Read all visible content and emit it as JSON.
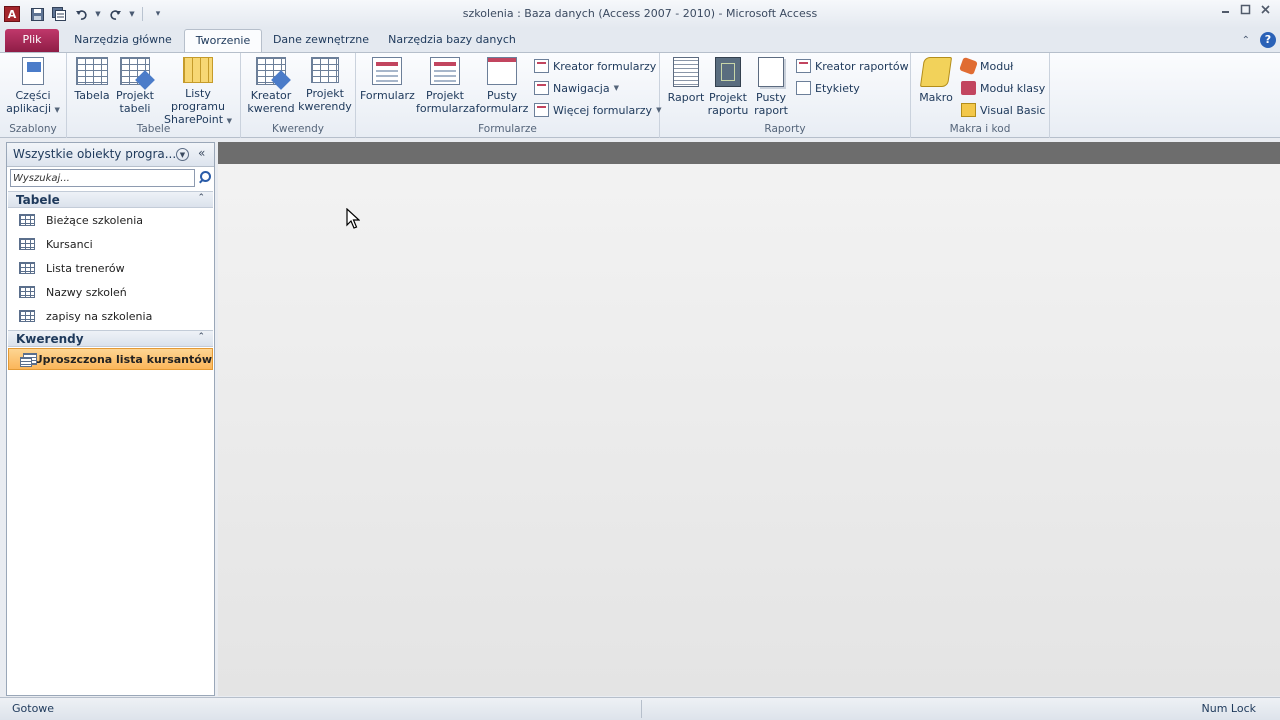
{
  "window": {
    "title": "szkolenia : Baza danych (Access 2007 - 2010)  -  Microsoft Access",
    "app_icon_letter": "A"
  },
  "tabs": [
    {
      "label": "Plik"
    },
    {
      "label": "Narzędzia główne"
    },
    {
      "label": "Tworzenie"
    },
    {
      "label": "Dane zewnętrzne"
    },
    {
      "label": "Narzędzia bazy danych"
    }
  ],
  "ribbon": {
    "groups": {
      "szablony": {
        "label": "Szablony",
        "parts_line1": "Części",
        "parts_line2": "aplikacji"
      },
      "tabele": {
        "label": "Tabele",
        "table": "Tabela",
        "table_design_line1": "Projekt",
        "table_design_line2": "tabeli",
        "sharepoint_line1": "Listy programu",
        "sharepoint_line2": "SharePoint"
      },
      "kwerendy": {
        "label": "Kwerendy",
        "wizard_line1": "Kreator",
        "wizard_line2": "kwerend",
        "design_line1": "Projekt",
        "design_line2": "kwerendy"
      },
      "formularze": {
        "label": "Formularze",
        "form": "Formularz",
        "form_design_line1": "Projekt",
        "form_design_line2": "formularza",
        "blank_form_line1": "Pusty",
        "blank_form_line2": "formularz",
        "form_wizard": "Kreator formularzy",
        "navigation": "Nawigacja",
        "more_forms": "Więcej formularzy"
      },
      "raporty": {
        "label": "Raporty",
        "report": "Raport",
        "report_design_line1": "Projekt",
        "report_design_line2": "raportu",
        "blank_report_line1": "Pusty",
        "blank_report_line2": "raport",
        "report_wizard": "Kreator raportów",
        "labels": "Etykiety"
      },
      "makra": {
        "label": "Makra i kod",
        "macro": "Makro",
        "module": "Moduł",
        "class_module": "Moduł klasy",
        "visual_basic": "Visual Basic"
      }
    }
  },
  "navpane": {
    "title": "Wszystkie obiekty progra...",
    "search_placeholder": "Wyszukaj...",
    "sections": [
      {
        "title": "Tabele",
        "items": [
          "Bieżące szkolenia",
          "Kursanci",
          "Lista trenerów",
          "Nazwy szkoleń",
          "zapisy na szkolenia"
        ]
      },
      {
        "title": "Kwerendy",
        "items": [
          "Uproszczona lista kursantów"
        ]
      }
    ],
    "selected_item": "Uproszczona lista kursantów"
  },
  "statusbar": {
    "left": "Gotowe",
    "right": "Num Lock"
  },
  "colors": {
    "file_tab": "#a72a5a",
    "selection": "#fbc56e",
    "workspace_bar": "#6d6d6d",
    "help": "#2b62b7"
  }
}
